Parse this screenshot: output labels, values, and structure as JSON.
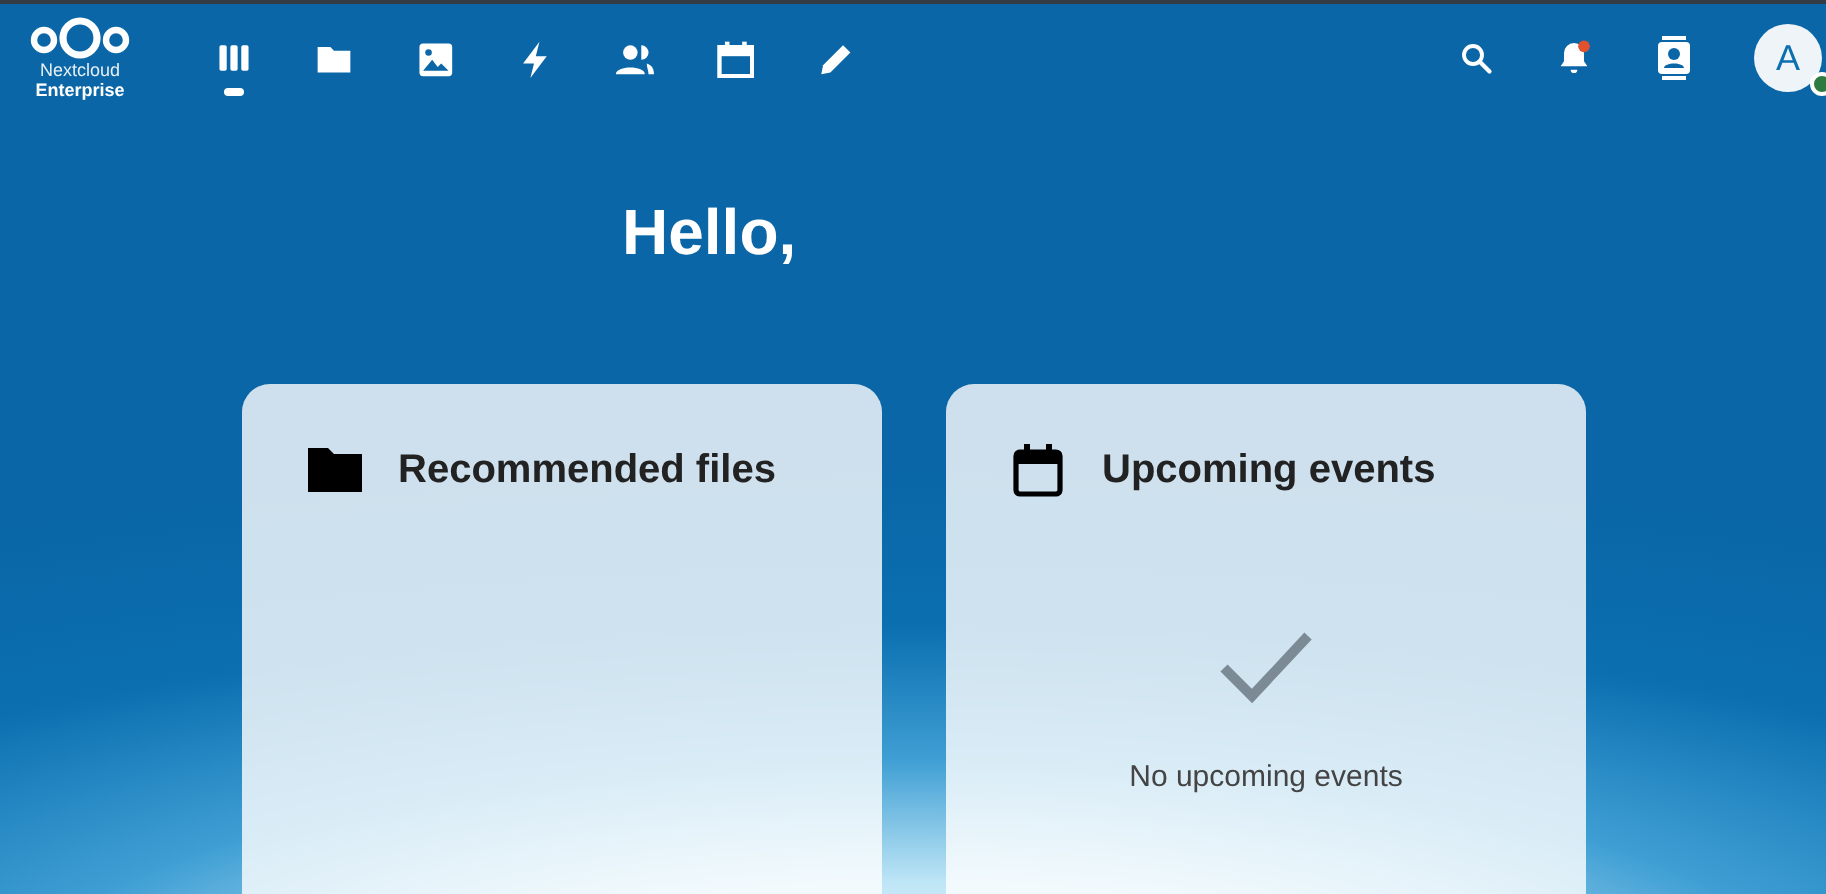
{
  "header": {
    "logo": {
      "line1": "Nextcloud",
      "line2": "Enterprise"
    },
    "apps": [
      {
        "kind": "dashboard",
        "selected": true
      },
      {
        "kind": "files",
        "selected": false
      },
      {
        "kind": "photos",
        "selected": false
      },
      {
        "kind": "activity",
        "selected": false
      },
      {
        "kind": "contacts",
        "selected": false
      },
      {
        "kind": "calendar",
        "selected": false
      },
      {
        "kind": "notes",
        "selected": false
      }
    ],
    "notifications_unread": true,
    "avatar": {
      "initial": "A",
      "online": true
    }
  },
  "greeting": "Hello,",
  "widgets": [
    {
      "kind": "files",
      "title": "Recommended files"
    },
    {
      "kind": "calendar",
      "title": "Upcoming events",
      "empty_message": "No upcoming events"
    }
  ]
}
